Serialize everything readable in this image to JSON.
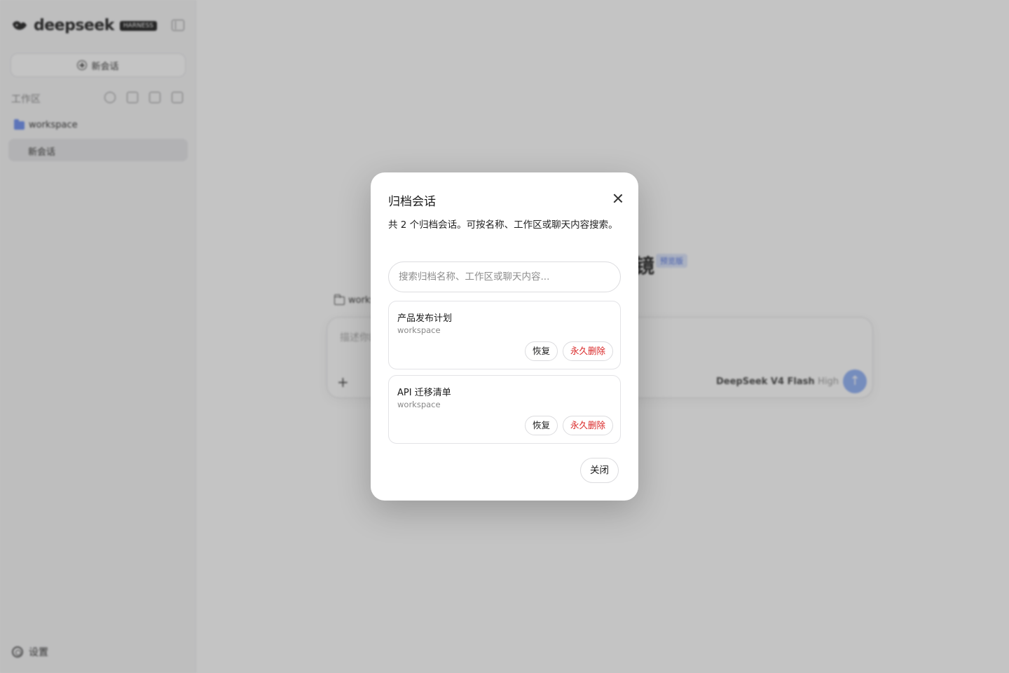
{
  "sidebar": {
    "brand": "deepseek",
    "brand_badge": "HARNESS",
    "new_chat_label": "新会话",
    "workspace_label": "工作区",
    "workspace_name": "workspace",
    "conversation": "新会话",
    "settings_label": "设置"
  },
  "main": {
    "hero_char": "镜",
    "hero_badge": "预览版",
    "composer_folder": "workspace",
    "composer_placeholder": "描述你的任务…",
    "composer_plus": "+",
    "model_name": "DeepSeek V4 Flash",
    "model_level": "High",
    "send_icon": "↑"
  },
  "modal": {
    "title": "归档会话",
    "description": "共 2 个归档会话。可按名称、工作区或聊天内容搜索。",
    "search_placeholder": "搜索归档名称、工作区或聊天内容...",
    "archived": [
      {
        "title": "产品发布计划",
        "workspace": "workspace",
        "restore": "恢复",
        "delete": "永久删除"
      },
      {
        "title": "API 迁移清单",
        "workspace": "workspace",
        "restore": "恢复",
        "delete": "永久删除"
      }
    ],
    "close_label": "关闭"
  },
  "colors": {
    "danger": "#d92525",
    "accent": "#6d8ff0",
    "overlay": "rgba(60,60,60,0.30)"
  }
}
